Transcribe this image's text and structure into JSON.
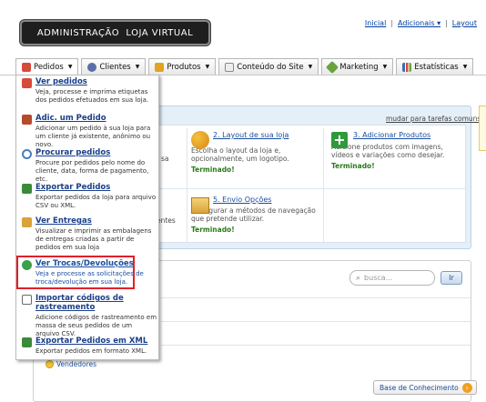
{
  "header": {
    "logo_text": "ADMINISTRAÇÃO  LOJA VIRTUAL",
    "links": [
      "Inicial",
      "Adicionais ▾",
      "Layout"
    ]
  },
  "nav": {
    "tabs": [
      {
        "label": "Pedidos",
        "icon": "orders-icon",
        "color": "#d64b3a"
      },
      {
        "label": "Clientes",
        "icon": "users-icon",
        "color": "#5a6fa8"
      },
      {
        "label": "Produtos",
        "icon": "products-icon",
        "color": "#e2a321"
      },
      {
        "label": "Conteúdo do Site",
        "icon": "page-icon",
        "color": "#8a8a8a"
      },
      {
        "label": "Marketing",
        "icon": "tag-icon",
        "color": "#6aa33a"
      },
      {
        "label": "Estatísticas",
        "icon": "chart-icon",
        "color": "#3a6fb8"
      }
    ]
  },
  "dropdown": {
    "items": [
      {
        "title": "Ver pedidos",
        "desc": "Veja, processe e imprima etiquetas dos pedidos efetuados em sua loja.",
        "icon": "orders-icon",
        "color": "#d64b3a"
      },
      {
        "title": "Adic. um Pedido",
        "desc": "Adicionar um pedido à sua loja para um cliente já existente, anônimo ou novo.",
        "icon": "add-order-icon",
        "color": "#b54a2c"
      },
      {
        "title": "Procurar pedidos",
        "desc": "Procure por pedidos pelo nome do cliente, data, forma de pagamento, etc.",
        "icon": "search-icon",
        "color": "#4a7cc0"
      },
      {
        "title": "Exportar Pedidos",
        "desc": "Exportar pedidos da loja para arquivo CSV ou XML.",
        "icon": "export-icon",
        "color": "#3a8a3a"
      },
      {
        "title": "Ver Entregas",
        "desc": "Visualizar e imprimir as embalagens de entregas criadas a partir de pedidos em sua loja",
        "icon": "box-icon",
        "color": "#d9a23a"
      },
      {
        "title": "Ver Trocas/Devoluções",
        "desc": "Veja e processe as solicitações de troca/devolução em sua loja.",
        "icon": "exchange-icon",
        "color": "#3aa04a"
      },
      {
        "title": "Importar códigos de rastreamento",
        "desc": "Adicione códigos de rastreamento em massa de seus pedidos de um arquivo CSV.",
        "icon": "import-icon",
        "color": "#6a6a6a"
      },
      {
        "title": "Exportar Pedidos em XML",
        "desc": "Exportar pedidos em formato XML.",
        "icon": "xml-icon",
        "color": "#3a8a3a"
      }
    ]
  },
  "main": {
    "mudar_link": "mudar para tarefas comuns",
    "tasks": [
      {
        "title": "2. Layout de sua loja",
        "desc": "Escolha o layout da loja e, opcionalmente, um logotipo.",
        "status": "Terminado!"
      },
      {
        "title": "3. Adicionar Produtos",
        "desc": "Adicione produtos com imagens, vídeos e variações como desejar.",
        "status": "Terminado!"
      },
      {
        "title": "5. Envio Opções",
        "desc": "Configurar a métodos de navegação que pretende utilizar.",
        "status": "Terminado!"
      }
    ],
    "partial_texts": [
      "sa",
      "entes"
    ],
    "search_placeholder": "busca...",
    "search_button": "Ir",
    "vendedores": "Vendedores",
    "knowledge_base": "Base de Conhecimento"
  }
}
